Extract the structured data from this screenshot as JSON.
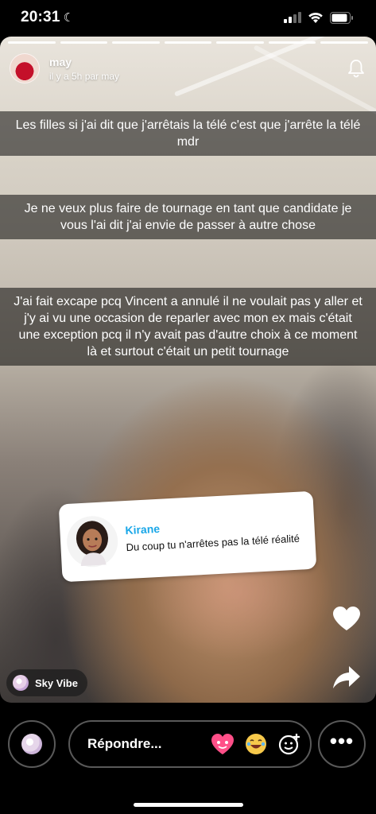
{
  "status_bar": {
    "time": "20:31"
  },
  "story": {
    "author": "may",
    "meta": "il y a 5h par may",
    "captions": [
      "Les filles si j'ai dit que j'arrêtais la télé c'est que j'arrête la télé mdr",
      "Je ne veux plus faire de tournage en tant que candidate je vous l'ai dit j'ai envie de passer à autre chose",
      "J'ai fait excape pcq Vincent a annulé il ne voulait pas y aller et j'y ai vu une occasion de reparler avec mon ex mais c'était une exception pcq il n'y avait pas d'autre choix à ce moment là et surtout c'était un petit tournage"
    ],
    "reply_card": {
      "name": "Kirane",
      "message": "Du coup tu n'arrêtes pas la télé réalité"
    },
    "sticker": "Sky Vibe"
  },
  "bottom": {
    "reply_label": "Répondre..."
  },
  "icons": [
    "moon-icon",
    "signal-icon",
    "wifi-icon",
    "battery-icon",
    "bell-icon",
    "heart-icon",
    "share-icon",
    "heart-emoji-icon",
    "laughing-emoji-icon",
    "add-sticker-icon",
    "more-icon"
  ],
  "colors": {
    "reply_name": "#1aa7e8",
    "caption_bg": "rgba(0,0,0,0.52)"
  }
}
